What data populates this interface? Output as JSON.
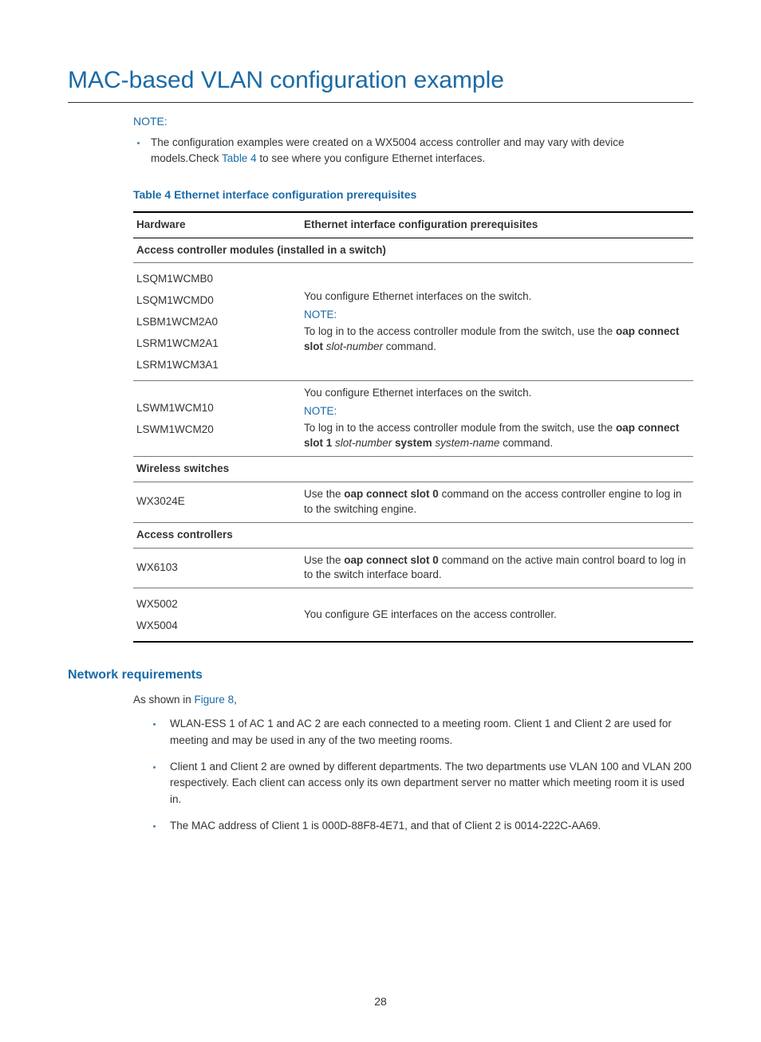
{
  "title": "MAC-based VLAN configuration example",
  "note": {
    "label": "NOTE:",
    "bullet_pre": "The configuration examples were created on a WX5004 access controller and may vary with device models.Check ",
    "bullet_link": "Table 4",
    "bullet_post": " to see where you configure Ethernet interfaces."
  },
  "table_caption": "Table 4 Ethernet interface configuration prerequisites",
  "table": {
    "head_hw": "Hardware",
    "head_req": "Ethernet interface configuration prerequisites",
    "section1": "Access controller modules (installed in a switch)",
    "row1_hw1": "LSQM1WCMB0",
    "row1_hw2": "LSQM1WCMD0",
    "row1_hw3": "LSBM1WCM2A0",
    "row1_hw4": "LSRM1WCM2A1",
    "row1_hw5": "LSRM1WCM3A1",
    "row1_req_line1": "You configure Ethernet interfaces on the switch.",
    "row1_req_note": "NOTE:",
    "row1_req_line2a": "To log in to the access controller module from the switch, use the ",
    "row1_req_line2b": "oap connect slot ",
    "row1_req_line2c": "slot-number",
    "row1_req_line2d": " command.",
    "row2_hw1": "LSWM1WCM10",
    "row2_hw2": "LSWM1WCM20",
    "row2_req_line1": "You configure Ethernet interfaces on the switch.",
    "row2_req_note": "NOTE:",
    "row2_req_line2a": "To log in to the access controller module from the switch, use the ",
    "row2_req_line2b": "oap connect slot 1 ",
    "row2_req_line2c": "slot-number",
    "row2_req_line2d": " system ",
    "row2_req_line2e": "system-name",
    "row2_req_line2f": " command.",
    "section2": "Wireless switches",
    "row3_hw": "WX3024E",
    "row3_req_a": "Use the ",
    "row3_req_b": "oap connect slot 0",
    "row3_req_c": " command on the access controller engine to log in to the switching engine.",
    "section3": "Access controllers",
    "row4_hw": "WX6103",
    "row4_req_a": "Use the ",
    "row4_req_b": "oap connect slot 0",
    "row4_req_c": " command on the active main control board to log in to the switch interface board.",
    "row5_hw1": "WX5002",
    "row5_hw2": "WX5004",
    "row5_req": "You configure GE interfaces on the access controller."
  },
  "requirements": {
    "heading": "Network requirements",
    "intro_a": "As shown in ",
    "intro_link": "Figure 8",
    "intro_b": ",",
    "b1": "WLAN-ESS 1 of AC 1 and AC 2 are each connected to a meeting room. Client 1 and Client 2 are used for meeting and may be used in any of the two meeting rooms.",
    "b2": "Client 1 and Client 2 are owned by different departments. The two departments use VLAN 100 and VLAN 200 respectively. Each client can access only its own department server no matter which meeting room it is used in.",
    "b3": "The MAC address of Client 1 is 000D-88F8-4E71, and that of Client 2 is 0014-222C-AA69."
  },
  "page": "28"
}
